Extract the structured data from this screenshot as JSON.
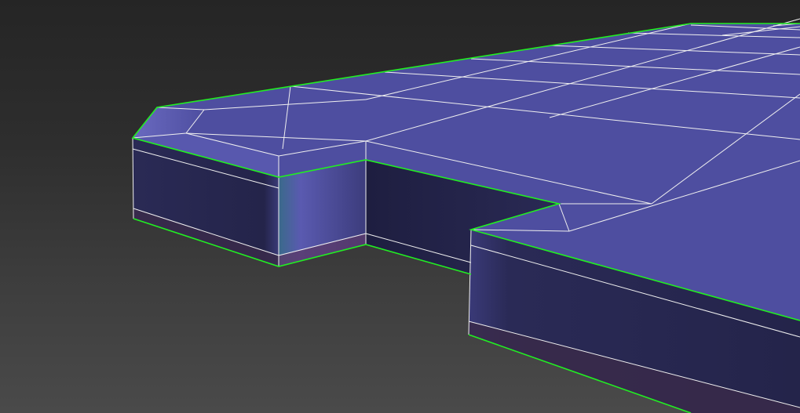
{
  "viewport": {
    "background_top": "#252525",
    "background_bottom": "#4a4a4a"
  },
  "model": {
    "object_type": "editable-poly-slab",
    "face_color": "#4e4ea0",
    "side_color_dark": "#24244a",
    "side_color_light": "#5a5aa8",
    "wireframe_color": "#ffffff",
    "selection_outline_color": "#22ee22",
    "selected": true
  }
}
